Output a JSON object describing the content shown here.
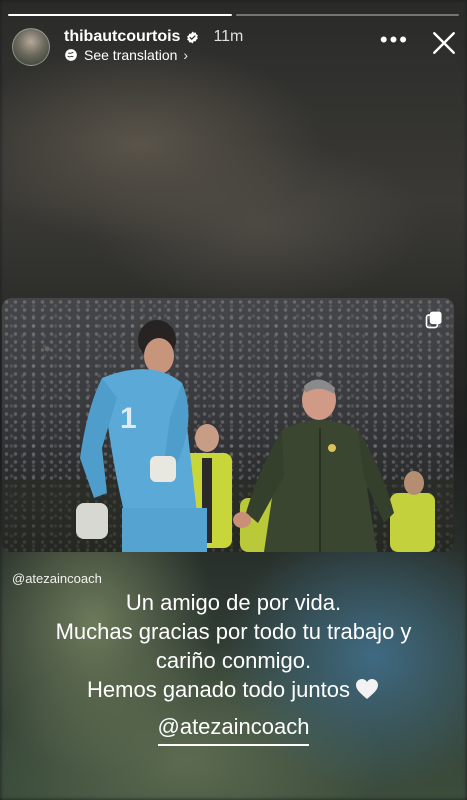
{
  "story": {
    "progress": [
      1.0,
      0.0
    ]
  },
  "header": {
    "username": "thibautcourtois",
    "time": "11m",
    "see_translation": "See translation"
  },
  "photo": {
    "credit": "@atezaincoach"
  },
  "caption": {
    "lines": [
      "Un amigo de por vida.",
      "Muchas gracias por todo tu trabajo y",
      "cariño conmigo.",
      "Hemos ganado todo juntos"
    ],
    "mention": "@atezaincoach"
  },
  "colors": {
    "heart": "#f2f2f2",
    "keeper_kit": "#5aa9d6",
    "coach_jacket": "#3b4631"
  },
  "icons": [
    "verified-icon",
    "globe-icon",
    "more-icon",
    "close-icon",
    "repost-icon",
    "heart-icon"
  ]
}
